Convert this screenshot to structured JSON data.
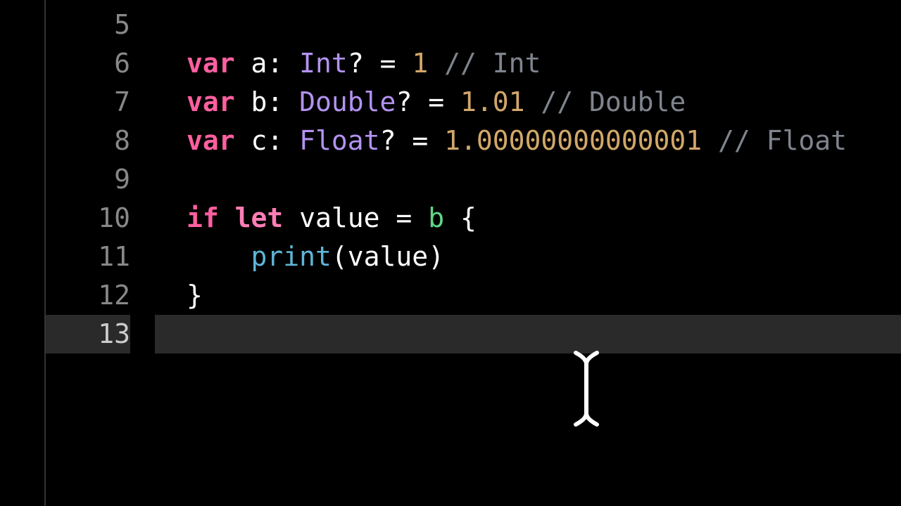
{
  "editor": {
    "first_line_number": 5,
    "current_line": 13,
    "lines": [
      {
        "n": 5,
        "tokens": []
      },
      {
        "n": 6,
        "tokens": [
          {
            "t": "var ",
            "c": "kw-pink"
          },
          {
            "t": "a",
            "c": "identifier"
          },
          {
            "t": ": ",
            "c": "operator"
          },
          {
            "t": "Int",
            "c": "type"
          },
          {
            "t": "? = ",
            "c": "operator"
          },
          {
            "t": "1",
            "c": "number"
          },
          {
            "t": " ",
            "c": "identifier"
          },
          {
            "t": "// Int",
            "c": "comment"
          }
        ]
      },
      {
        "n": 7,
        "tokens": [
          {
            "t": "var ",
            "c": "kw-pink"
          },
          {
            "t": "b",
            "c": "identifier"
          },
          {
            "t": ": ",
            "c": "operator"
          },
          {
            "t": "Double",
            "c": "type"
          },
          {
            "t": "? = ",
            "c": "operator"
          },
          {
            "t": "1.01",
            "c": "number"
          },
          {
            "t": " ",
            "c": "identifier"
          },
          {
            "t": "// Double",
            "c": "comment"
          }
        ]
      },
      {
        "n": 8,
        "tokens": [
          {
            "t": "var ",
            "c": "kw-pink"
          },
          {
            "t": "c",
            "c": "identifier"
          },
          {
            "t": ": ",
            "c": "operator"
          },
          {
            "t": "Float",
            "c": "type"
          },
          {
            "t": "? = ",
            "c": "operator"
          },
          {
            "t": "1.00000000000001",
            "c": "number"
          },
          {
            "t": " ",
            "c": "identifier"
          },
          {
            "t": "// Float",
            "c": "comment"
          }
        ]
      },
      {
        "n": 9,
        "tokens": []
      },
      {
        "n": 10,
        "tokens": [
          {
            "t": "if ",
            "c": "kw-pink"
          },
          {
            "t": "let ",
            "c": "kw-lightpink"
          },
          {
            "t": "value",
            "c": "identifier"
          },
          {
            "t": " = ",
            "c": "operator"
          },
          {
            "t": "b",
            "c": "var-green"
          },
          {
            "t": " ",
            "c": "identifier"
          },
          {
            "t": "{",
            "c": "brace"
          }
        ]
      },
      {
        "n": 11,
        "tokens": [
          {
            "t": "    ",
            "c": "identifier"
          },
          {
            "t": "print",
            "c": "func"
          },
          {
            "t": "(",
            "c": "paren"
          },
          {
            "t": "value",
            "c": "identifier"
          },
          {
            "t": ")",
            "c": "paren"
          }
        ]
      },
      {
        "n": 12,
        "tokens": [
          {
            "t": "}",
            "c": "brace"
          }
        ]
      },
      {
        "n": 13,
        "tokens": []
      }
    ]
  }
}
